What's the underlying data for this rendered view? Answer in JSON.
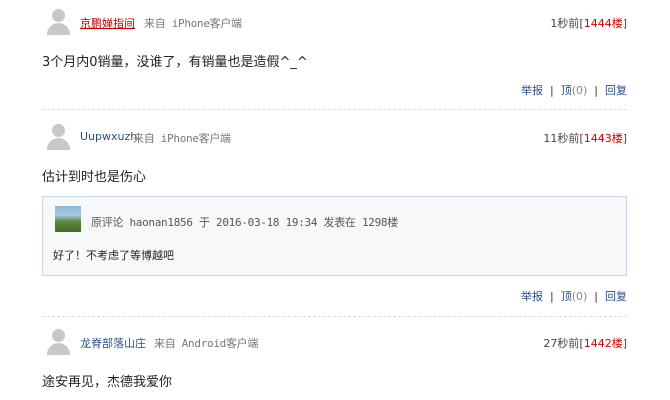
{
  "comments": [
    {
      "user": "京鹏婵指间",
      "from": "来自 iPhone客户端",
      "time": "1秒前",
      "floor": "1444楼",
      "text": "3个月内0销量，没谁了，有销量也是造假^_^",
      "actions": {
        "report": "举报",
        "up": "顶",
        "up_count": "(0)",
        "reply": "回复"
      }
    },
    {
      "user": "Uupwxuzh",
      "from": "来自 iPhone客户端",
      "time": "11秒前",
      "floor": "1443楼",
      "text": "估计到时也是伤心",
      "quote": {
        "label": "原评论",
        "user": "haonan1856",
        "at": "于",
        "datetime": "2016-03-18 19:34",
        "posted": "发表在",
        "floor": "1298楼",
        "text": "好了！不考虑了等博越吧"
      },
      "actions": {
        "report": "举报",
        "up": "顶",
        "up_count": "(0)",
        "reply": "回复"
      }
    },
    {
      "user": "龙脊部落山庄",
      "from": "来自 Android客户端",
      "time": "27秒前",
      "floor": "1442楼",
      "text": "途安再见，杰德我爱你"
    }
  ]
}
